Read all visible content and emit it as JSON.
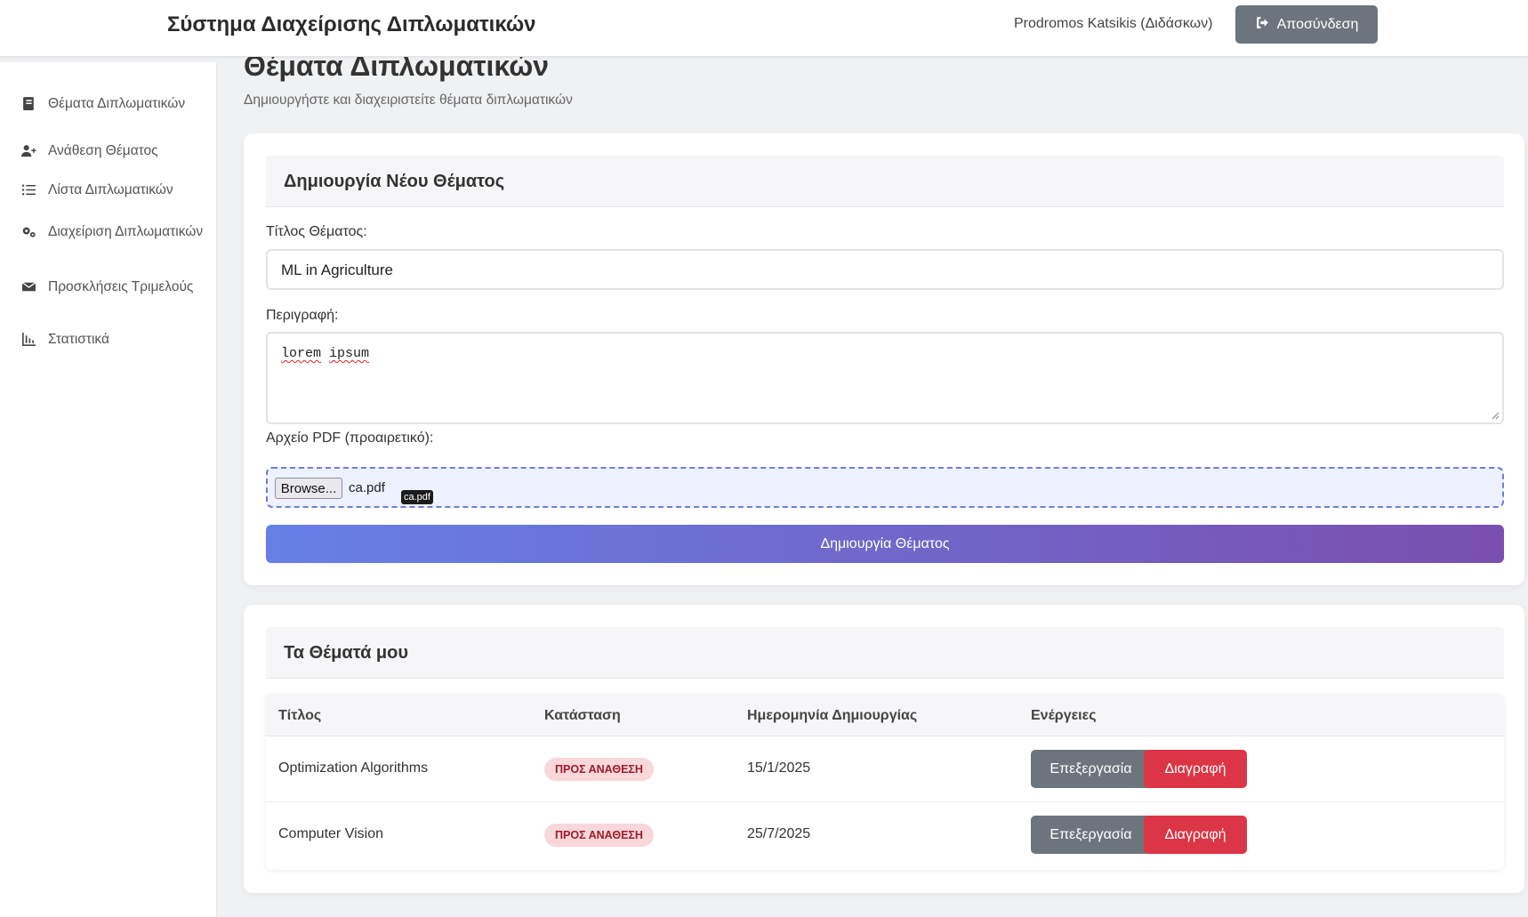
{
  "header": {
    "app_title": "Σύστημα Διαχείρισης Διπλωματικών",
    "user": "Prodromos Katsikis (Διδάσκων)",
    "logout_label": "Αποσύνδεση"
  },
  "sidebar": {
    "items": [
      {
        "label": "Θέματα Διπλωματικών",
        "icon": "book-icon"
      },
      {
        "label": "Ανάθεση Θέματος",
        "icon": "user-plus-icon"
      },
      {
        "label": "Λίστα Διπλωματικών",
        "icon": "list-icon"
      },
      {
        "label": "Διαχείριση Διπλωματικών",
        "icon": "gears-icon"
      },
      {
        "label": "Προσκλήσεις Τριμελούς",
        "icon": "envelope-icon"
      },
      {
        "label": "Στατιστικά",
        "icon": "chart-icon"
      }
    ]
  },
  "page": {
    "title": "Θέματα Διπλωματικών",
    "subtitle": "Δημιουργήστε και διαχειριστείτε θέματα διπλωματικών"
  },
  "create_form": {
    "heading": "Δημιουργία Νέου Θέματος",
    "title_label": "Τίτλος Θέματος:",
    "title_value": "ML in Agriculture",
    "description_label": "Περιγραφή:",
    "description_words": [
      "lorem",
      "ipsum"
    ],
    "pdf_label": "Αρχείο PDF (προαιρετικό):",
    "browse_label": "Browse...",
    "file_name": "ca.pdf",
    "file_tooltip": "ca.pdf",
    "submit_label": "Δημιουργία Θέματος"
  },
  "my_topics": {
    "heading": "Τα Θέματά μου",
    "columns": [
      "Τίτλος",
      "Κατάσταση",
      "Ημερομηνία Δημιουργίας",
      "Ενέργειες"
    ],
    "rows": [
      {
        "title": "Optimization Algorithms",
        "status": "ΠΡΟΣ ΑΝΑΘΕΣΗ",
        "created": "15/1/2025",
        "edit": "Επεξεργασία",
        "delete": "Διαγραφή"
      },
      {
        "title": "Computer Vision",
        "status": "ΠΡΟΣ ΑΝΑΘΕΣΗ",
        "created": "25/7/2025",
        "edit": "Επεξεργασία",
        "delete": "Διαγραφή"
      }
    ]
  },
  "colors": {
    "primary_gradient_start": "#6680e6",
    "primary_gradient_end": "#7a4fae",
    "secondary": "#6c757d",
    "danger": "#dc3545",
    "badge_bg": "#f9d7db",
    "badge_text": "#9c1c2a"
  }
}
